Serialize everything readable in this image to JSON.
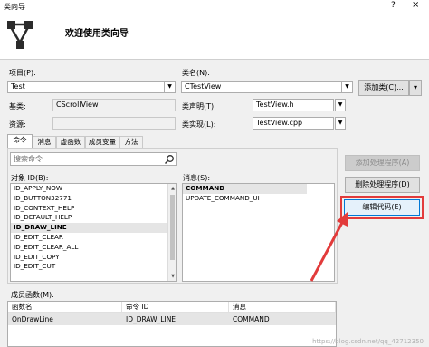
{
  "window": {
    "title": "类向导",
    "help": "?",
    "close": "×"
  },
  "header": {
    "welcome": "欢迎使用类向导"
  },
  "project": {
    "label": "项目(P):",
    "value": "Test"
  },
  "classname": {
    "label": "类名(N):",
    "value": "CTestView"
  },
  "add_class": {
    "label": "添加类(C)...",
    "arrow": "▾"
  },
  "base": {
    "label": "基类:",
    "value": "CScrollView"
  },
  "resource": {
    "label": "资源:",
    "value": ""
  },
  "declaration": {
    "label": "类声明(T):",
    "value": "TestView.h"
  },
  "implementation": {
    "label": "类实现(L):",
    "value": "TestView.cpp"
  },
  "tabs": [
    "命令",
    "消息",
    "虚函数",
    "成员变量",
    "方法"
  ],
  "search": {
    "placeholder": "搜索命令"
  },
  "object_ids": {
    "label": "对象 ID(B):",
    "items": [
      "ID_APPLY_NOW",
      "ID_BUTTON32771",
      "ID_CONTEXT_HELP",
      "ID_DEFAULT_HELP",
      "ID_DRAW_LINE",
      "ID_EDIT_CLEAR",
      "ID_EDIT_CLEAR_ALL",
      "ID_EDIT_COPY",
      "ID_EDIT_CUT"
    ],
    "selected_index": 4
  },
  "messages": {
    "label": "消息(S):",
    "items": [
      "COMMAND",
      "UPDATE_COMMAND_UI"
    ],
    "selected_index": 0
  },
  "buttons": {
    "add_handler": "添加处理程序(A)",
    "delete_handler": "删除处理程序(D)",
    "edit_code": "编辑代码(E)"
  },
  "members": {
    "label": "成员函数(M):",
    "columns": [
      "函数名",
      "命令 ID",
      "消息"
    ],
    "rows": [
      [
        "OnDrawLine",
        "ID_DRAW_LINE",
        "COMMAND"
      ]
    ]
  },
  "watermark": "https://blog.csdn.net/qq_42712350",
  "colors": {
    "highlight_red": "#e23b3b",
    "focus_blue": "#0078d7"
  }
}
